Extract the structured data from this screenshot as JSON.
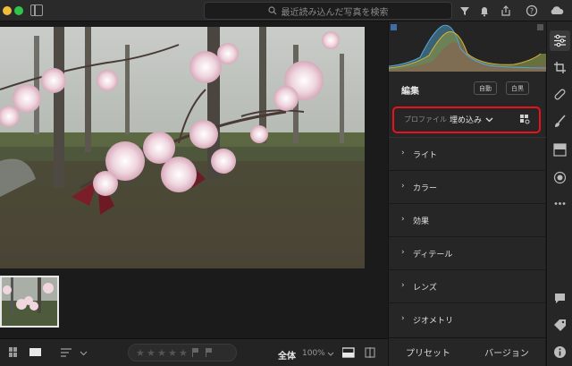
{
  "topbar": {
    "search_placeholder": "最近読み込んだ写真を検索"
  },
  "bottombar": {
    "rating_stars": [
      "★",
      "★",
      "★",
      "★",
      "★"
    ],
    "fit_label": "全体",
    "zoom_label": "100%"
  },
  "edit_panel": {
    "title": "編集",
    "auto_button": "自動",
    "bw_button": "白黒",
    "profile": {
      "label": "プロファイル",
      "value": "埋め込み"
    },
    "sections": [
      {
        "label": "ライト"
      },
      {
        "label": "カラー"
      },
      {
        "label": "効果"
      },
      {
        "label": "ディテール"
      },
      {
        "label": "レンズ"
      },
      {
        "label": "ジオメトリ"
      }
    ],
    "chevron": "›",
    "tabs": {
      "presets": "プリセット",
      "versions": "バージョン"
    }
  },
  "toolbar_right": {
    "icons": [
      "sliders-icon",
      "crop-icon",
      "healing-icon",
      "brush-icon",
      "linear-gradient-icon",
      "radial-gradient-icon",
      "more-icon",
      "comment-icon",
      "tag-icon",
      "info-icon"
    ]
  },
  "colors": {
    "accent_highlight": "#e8131a",
    "panel_bg": "#262626",
    "app_bg": "#1b1b1b"
  }
}
